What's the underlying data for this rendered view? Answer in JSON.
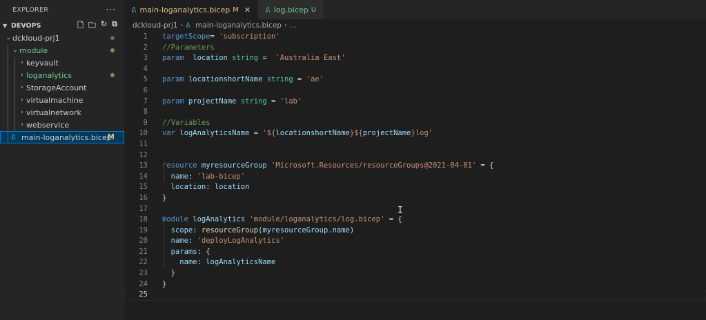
{
  "sidebar": {
    "title": "EXPLORER",
    "more": "···",
    "section": "DEVOPS",
    "tree": [
      {
        "label": "dckloud-prj1",
        "type": "folder",
        "open": true,
        "depth": 0,
        "dot": "#6e6e4a"
      },
      {
        "label": "module",
        "type": "folder",
        "open": true,
        "depth": 1,
        "dot": "#6a9955",
        "green": true
      },
      {
        "label": "keyvault",
        "type": "folder",
        "open": false,
        "depth": 2
      },
      {
        "label": "loganalytics",
        "type": "folder",
        "open": false,
        "depth": 2,
        "dot": "#6a9955",
        "green": true
      },
      {
        "label": "StorageAccount",
        "type": "folder",
        "open": false,
        "depth": 2
      },
      {
        "label": "virtualmachine",
        "type": "folder",
        "open": false,
        "depth": 2
      },
      {
        "label": "virtualnetwork",
        "type": "folder",
        "open": false,
        "depth": 2
      },
      {
        "label": "webservice",
        "type": "folder",
        "open": false,
        "depth": 2
      },
      {
        "label": "main-loganalytics.bicep",
        "type": "file",
        "depth": 1,
        "badge": "M",
        "selected": true
      }
    ]
  },
  "tabs": [
    {
      "label": "main-loganalytics.bicep",
      "status": "M",
      "active": true
    },
    {
      "label": "log.bicep",
      "status": "U",
      "active": false
    }
  ],
  "breadcrumb": {
    "folder": "dckloud-prj1",
    "file": "main-loganalytics.bicep",
    "rest": "..."
  },
  "code": [
    [
      [
        "kw",
        "targetScope"
      ],
      [
        "",
        "= "
      ],
      [
        "str",
        "'subscription'"
      ]
    ],
    [
      [
        "cmt",
        "//Parameters"
      ]
    ],
    [
      [
        "kw",
        "param"
      ],
      [
        "",
        " "
      ],
      [
        "id",
        " location"
      ],
      [
        "",
        " "
      ],
      [
        "ty",
        "string"
      ],
      [
        "",
        " =  "
      ],
      [
        "str",
        "'Australia East'"
      ]
    ],
    [],
    [
      [
        "kw",
        "param"
      ],
      [
        "",
        " "
      ],
      [
        "id",
        "locationshortName"
      ],
      [
        "",
        " "
      ],
      [
        "ty",
        "string"
      ],
      [
        "",
        " = "
      ],
      [
        "str",
        "'ae'"
      ]
    ],
    [],
    [
      [
        "kw",
        "param"
      ],
      [
        "",
        " "
      ],
      [
        "id",
        "projectName"
      ],
      [
        "",
        " "
      ],
      [
        "ty",
        "string"
      ],
      [
        "",
        " = "
      ],
      [
        "str",
        "'lab'"
      ]
    ],
    [],
    [
      [
        "cmt",
        "//Variables"
      ]
    ],
    [
      [
        "kw",
        "var"
      ],
      [
        "",
        " "
      ],
      [
        "id",
        "logAnalyticsName"
      ],
      [
        "",
        " = "
      ],
      [
        "str",
        "'${"
      ],
      [
        "id",
        "locationshortName"
      ],
      [
        "str",
        "}${"
      ],
      [
        "id",
        "projectName"
      ],
      [
        "str",
        "}log'"
      ]
    ],
    [],
    [],
    [
      [
        "kw",
        "resource"
      ],
      [
        "",
        " "
      ],
      [
        "id",
        "myresourceGroup"
      ],
      [
        "",
        " "
      ],
      [
        "str",
        "'Microsoft.Resources/resourceGroups@2021-04-01'"
      ],
      [
        "",
        " = {"
      ]
    ],
    [
      [
        "",
        ""
      ],
      [
        "id",
        "  name"
      ],
      [
        "",
        ": "
      ],
      [
        "str",
        "'lab-bicep'"
      ]
    ],
    [
      [
        "id",
        "  location"
      ],
      [
        "",
        ": "
      ],
      [
        "id",
        "location"
      ]
    ],
    [
      [
        "",
        "}"
      ]
    ],
    [],
    [
      [
        "kw",
        "module"
      ],
      [
        "",
        " "
      ],
      [
        "id",
        "logAnalytics"
      ],
      [
        "",
        " "
      ],
      [
        "str",
        "'module/loganalytics/log.bicep'"
      ],
      [
        "",
        " = {"
      ]
    ],
    [
      [
        "id",
        "  scope"
      ],
      [
        "",
        ": "
      ],
      [
        "fn",
        "resourceGroup"
      ],
      [
        "",
        "("
      ],
      [
        "id",
        "myresourceGroup"
      ],
      [
        "",
        "."
      ],
      [
        "id",
        "name"
      ],
      [
        "",
        ")"
      ]
    ],
    [
      [
        "id",
        "  name"
      ],
      [
        "",
        ": "
      ],
      [
        "str",
        "'deployLogAnalytics'"
      ]
    ],
    [
      [
        "id",
        "  params"
      ],
      [
        "",
        ": {"
      ]
    ],
    [
      [
        "id",
        "    name"
      ],
      [
        "",
        ": "
      ],
      [
        "id",
        "logAnalyticsName"
      ]
    ],
    [
      [
        "",
        "  }"
      ]
    ],
    [
      [
        "",
        "}"
      ]
    ],
    []
  ],
  "current_line": 25,
  "colors": {
    "accent": "#007fd4",
    "modified": "#e2c08d",
    "untracked": "#73c991"
  }
}
